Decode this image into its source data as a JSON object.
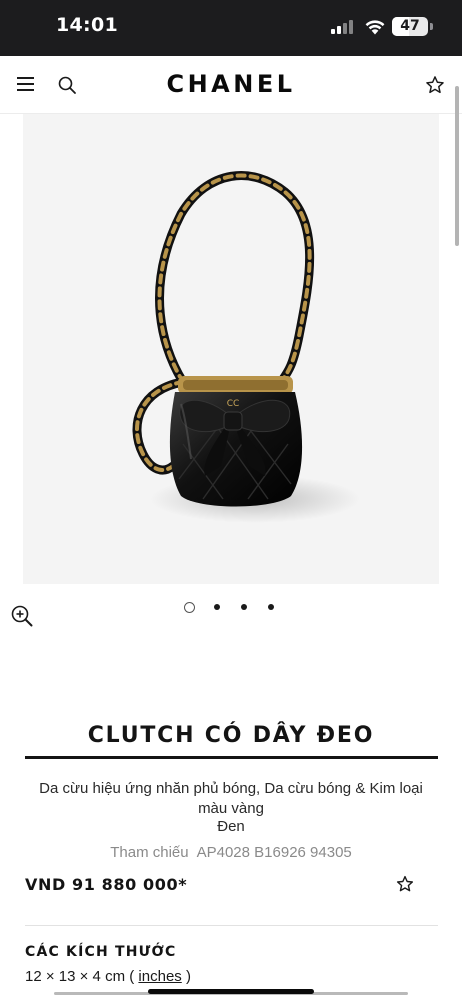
{
  "status_bar": {
    "time": "14:01",
    "battery_level": "47"
  },
  "header": {
    "brand": "CHANEL",
    "icons": [
      "menu-icon",
      "search-icon",
      "star-icon"
    ]
  },
  "gallery": {
    "image_count": 4,
    "active_index": 0,
    "zoom_icon": "zoom-in-icon"
  },
  "product": {
    "title": "CLUTCH CÓ DÂY ĐEO",
    "description": "Da cừu hiệu ứng nhăn phủ bóng, Da cừu bóng & Kim loại màu vàng",
    "color": "Đen",
    "reference_label": "Tham chiếu",
    "reference_code": "AP4028 B16926 94305",
    "price": "VND 91 880 000*",
    "dimensions_heading": "CÁC KÍCH THƯỚC",
    "dimensions_value": "12 × 13 × 4 cm",
    "dimensions_open": " ( ",
    "dimensions_unit_link": "inches",
    "dimensions_close": " )"
  },
  "colors": {
    "status_bar_bg": "#1c1c1e",
    "image_bg": "#f4f4f4",
    "text": "#141414",
    "muted": "#8a8a8a",
    "gold": "#b8944a"
  }
}
